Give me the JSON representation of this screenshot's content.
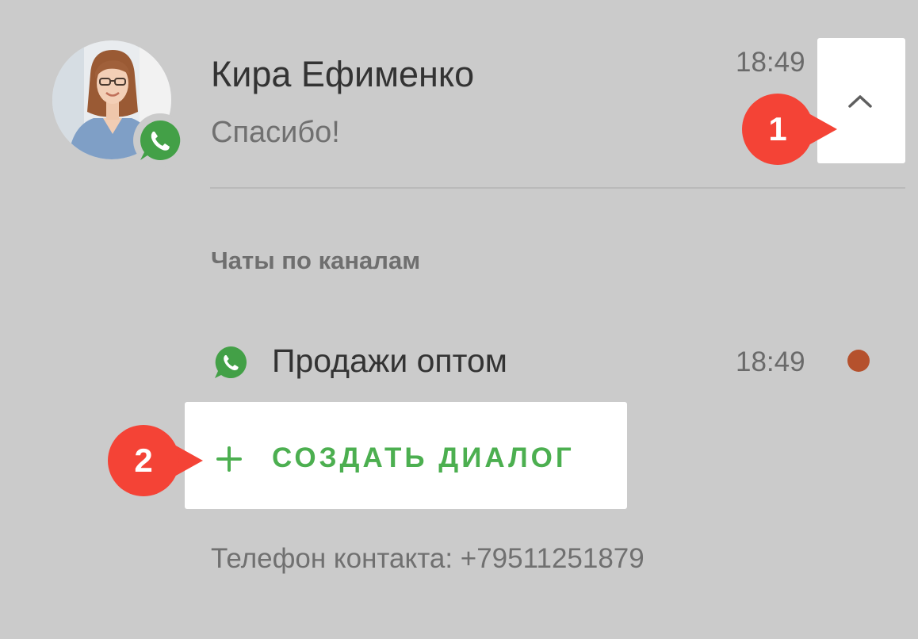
{
  "contact": {
    "name": "Кира Ефименко",
    "last_message": "Спасибо!",
    "time": "18:49",
    "avatar_icon": "person-photo-avatar",
    "messenger_icon": "whatsapp-icon"
  },
  "header": {
    "collapse_icon": "chevron-up-icon"
  },
  "channels_section": {
    "title": "Чаты по каналам",
    "items": [
      {
        "icon": "whatsapp-icon",
        "name": "Продажи оптом",
        "time": "18:49",
        "unread_indicator_color": "#b5512d"
      }
    ]
  },
  "create_dialog": {
    "icon": "plus-icon",
    "label": "СОЗДАТЬ ДИАЛОГ"
  },
  "phone": {
    "text": "Телефон контакта: +79511251879"
  },
  "callouts": [
    {
      "label": "1"
    },
    {
      "label": "2"
    }
  ],
  "colors": {
    "background": "#cbcbcb",
    "accent_green": "#4caf50",
    "whatsapp_green": "#43a047",
    "callout_red": "#f44336",
    "unread_dot": "#b5512d"
  }
}
